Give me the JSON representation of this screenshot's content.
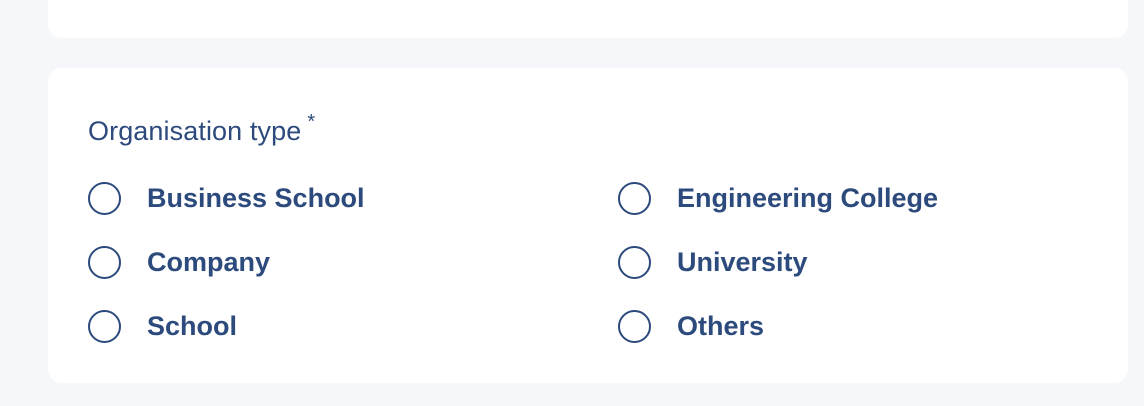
{
  "form": {
    "question": {
      "label": "Organisation type",
      "required_marker": "*"
    },
    "options": [
      {
        "label": "Business School",
        "selected": false
      },
      {
        "label": "Engineering College",
        "selected": false
      },
      {
        "label": "Company",
        "selected": false
      },
      {
        "label": "University",
        "selected": false
      },
      {
        "label": "School",
        "selected": false
      },
      {
        "label": "Others",
        "selected": false
      }
    ]
  },
  "colors": {
    "page_background": "#f5f7fa",
    "card_background": "#ffffff",
    "text": "#2d4a7c"
  }
}
